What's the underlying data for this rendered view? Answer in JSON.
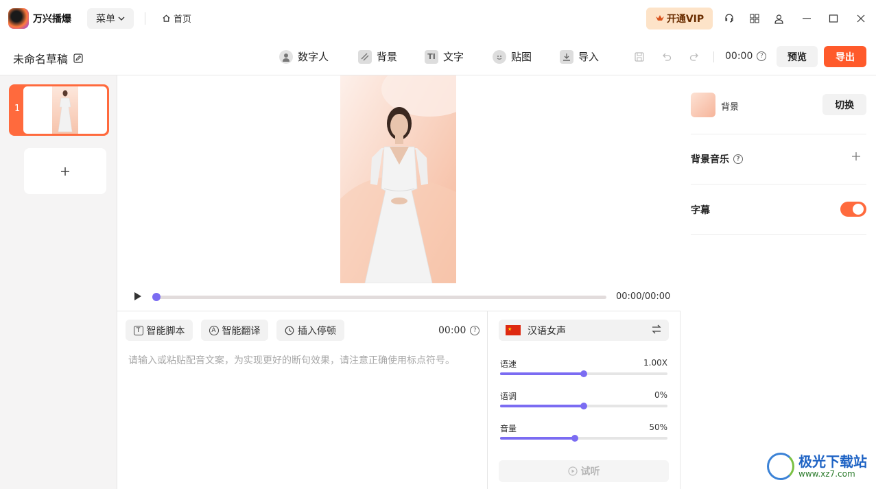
{
  "titlebar": {
    "app_name": "万兴播爆",
    "menu_label": "菜单",
    "home_label": "首页",
    "vip_label": "开通VIP"
  },
  "toolbar": {
    "draft_title": "未命名草稿",
    "tools": [
      {
        "label": "数字人",
        "icon": "digital-human-icon"
      },
      {
        "label": "背景",
        "icon": "background-icon"
      },
      {
        "label": "文字",
        "icon": "text-icon"
      },
      {
        "label": "贴图",
        "icon": "sticker-icon"
      },
      {
        "label": "导入",
        "icon": "import-icon"
      }
    ],
    "time": "00:00",
    "preview_label": "预览",
    "export_label": "导出"
  },
  "slides": {
    "items": [
      {
        "number": "1"
      }
    ]
  },
  "player": {
    "time_display": "00:00/00:00",
    "progress": 0
  },
  "script": {
    "buttons": [
      {
        "label": "智能脚本",
        "icon": "T"
      },
      {
        "label": "智能翻译",
        "icon": "A"
      },
      {
        "label": "插入停顿",
        "icon": "clock"
      }
    ],
    "time": "00:00",
    "placeholder": "请输入或粘贴配音文案，为实现更好的断句效果，请注意正确使用标点符号。"
  },
  "voice": {
    "name": "汉语女声",
    "sliders": [
      {
        "label": "语速",
        "value": "1.00X",
        "fraction": 0.5
      },
      {
        "label": "语调",
        "value": "0%",
        "fraction": 0.5
      },
      {
        "label": "音量",
        "value": "50%",
        "fraction": 0.45
      }
    ],
    "listen_label": "试听"
  },
  "right_panel": {
    "background_label": "背景",
    "switch_label": "切换",
    "bgm_label": "背景音乐",
    "subtitle_label": "字幕",
    "subtitle_enabled": true
  },
  "watermark": {
    "title": "极光下载站",
    "url": "www.xz7.com"
  },
  "colors": {
    "accent": "#ff5a2b",
    "slider": "#7b6cf2",
    "vip_bg": "#fde3c8"
  }
}
